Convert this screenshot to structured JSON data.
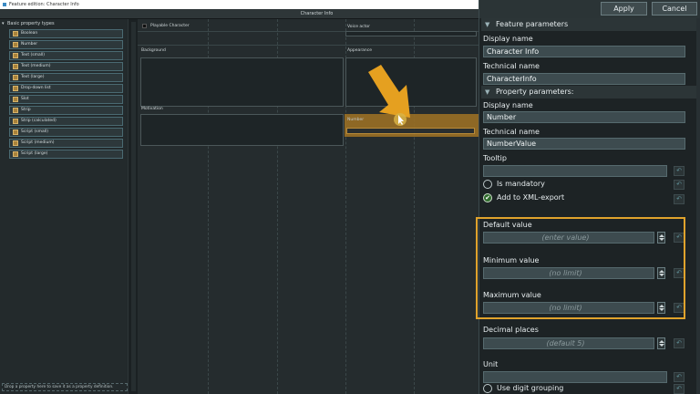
{
  "window": {
    "title": "Feature edition: Character Info",
    "canvas_caption": "Character Info"
  },
  "toolbar": {
    "apply_label": "Apply",
    "cancel_label": "Cancel"
  },
  "tools": {
    "group_label": "Basic property types",
    "items": [
      "Boolean",
      "Number",
      "Text (small)",
      "Text (medium)",
      "Text (large)",
      "Drop-down list",
      "Slot",
      "Strip",
      "Strip (calculated)",
      "Script (small)",
      "Script (medium)",
      "Script (large)"
    ],
    "footer": "Drop a property here to save it as a property definition."
  },
  "canvas": {
    "playable_label": "Playable Character",
    "voice_actor_label": "Voice actor",
    "background_label": "Background",
    "appearance_label": "Appearance",
    "motivation_label": "Motivation",
    "number_label": "Number"
  },
  "feature_params": {
    "header": "Feature parameters",
    "display_name_label": "Display name",
    "display_name_value": "Character Info",
    "technical_name_label": "Technical name",
    "technical_name_value": "CharacterInfo"
  },
  "property_params": {
    "header": "Property parameters:",
    "display_name_label": "Display name",
    "display_name_value": "Number",
    "technical_name_label": "Technical name",
    "technical_name_value": "NumberValue",
    "tooltip_label": "Tooltip",
    "tooltip_value": "",
    "is_mandatory_label": "Is mandatory",
    "is_mandatory": false,
    "xml_export_label": "Add to XML-export",
    "xml_export": true,
    "default_value_label": "Default value",
    "default_value_placeholder": "(enter value)",
    "min_value_label": "Minimum value",
    "min_value_placeholder": "(no limit)",
    "max_value_label": "Maximum value",
    "max_value_placeholder": "(no limit)",
    "decimal_places_label": "Decimal places",
    "decimal_places_placeholder": "(default 5)",
    "unit_label": "Unit",
    "unit_value": "",
    "digit_grouping_label": "Use digit grouping",
    "digit_grouping": false
  },
  "colors": {
    "accent": "#e0a32c",
    "panel": "#1d2325",
    "field": "#3d4b4f"
  }
}
